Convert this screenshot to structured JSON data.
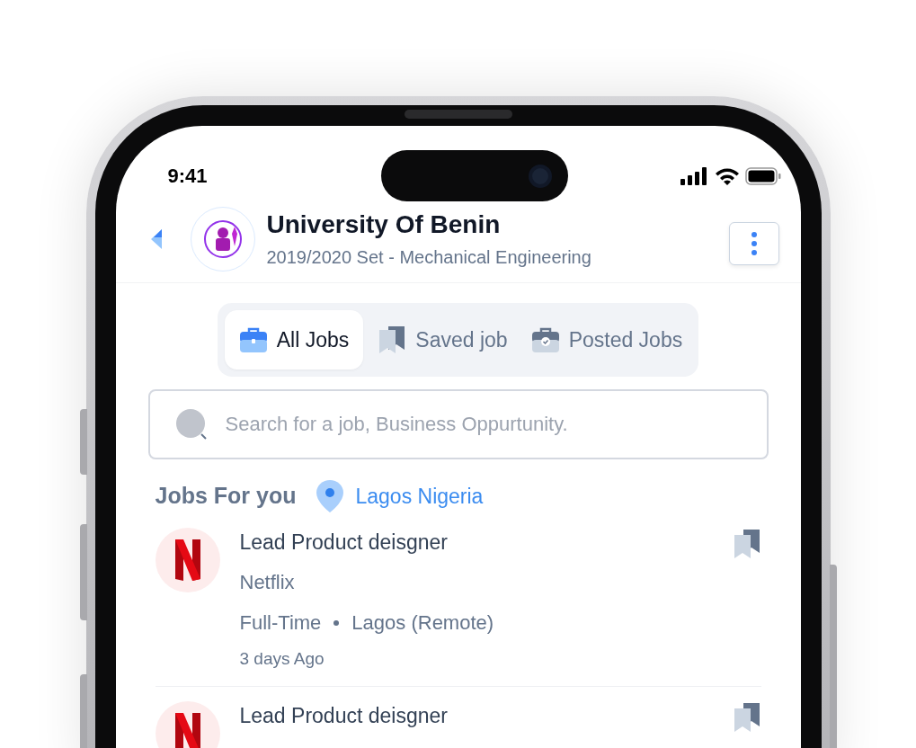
{
  "status_bar": {
    "time": "9:41"
  },
  "header": {
    "title": "University Of Benin",
    "subtitle": "2019/2020 Set - Mechanical Engineering"
  },
  "tabs": [
    {
      "label": "All Jobs",
      "selected": true,
      "kind": "briefcase"
    },
    {
      "label": "Saved job",
      "selected": false,
      "kind": "bookmark"
    },
    {
      "label": "Posted Jobs",
      "selected": false,
      "kind": "posted"
    }
  ],
  "search": {
    "placeholder": "Search for a job, Business Oppurtunity."
  },
  "section": {
    "title": "Jobs For you",
    "location": "Lagos Nigeria"
  },
  "jobs": [
    {
      "title": "Lead Product deisgner",
      "company": "Netflix",
      "type": "Full-Time",
      "location": "Lagos (Remote)",
      "posted": "3 days Ago"
    },
    {
      "title": "Lead Product deisgner"
    }
  ]
}
